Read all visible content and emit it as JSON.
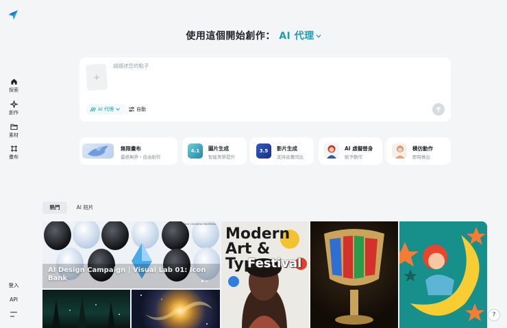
{
  "nav": {
    "items": [
      {
        "label": "探索",
        "icon": "home-icon"
      },
      {
        "label": "創作",
        "icon": "sparkle-icon"
      },
      {
        "label": "素材",
        "icon": "folder-icon"
      },
      {
        "label": "畫布",
        "icon": "canvas-icon"
      }
    ],
    "login_label": "登入",
    "api_label": "API"
  },
  "heading": {
    "prefix": "使用這個開始創作：",
    "mode": "AI 代理"
  },
  "prompt": {
    "placeholder": "請描述您的點子",
    "agent_chip": "AI 代理",
    "auto_chip": "自動"
  },
  "features": [
    {
      "title": "無限畫布",
      "desc": "靈感無界・自由創作"
    },
    {
      "title": "圖片生成",
      "desc": "智能美學提升"
    },
    {
      "title": "影片生成",
      "desc": "支持音畫同出"
    },
    {
      "title": "AI 虛擬替身",
      "desc": "賦予動作"
    },
    {
      "title": "模仿動作",
      "desc": "即時推出"
    }
  ],
  "tabs": [
    {
      "label": "熱門",
      "active": true
    },
    {
      "label": "AI 短片",
      "active": false
    }
  ],
  "gallery": {
    "featured_caption": "AI Design Campaign | Visual Lab 01: Icon Bank",
    "poster_line1": "Modern",
    "poster_line2": "Art & Type",
    "poster_line3": "Festival",
    "small_print": "Clear Circulation Workflows"
  },
  "colors": {
    "accent": "#1a9fb5",
    "background": "#f4f5f7"
  }
}
